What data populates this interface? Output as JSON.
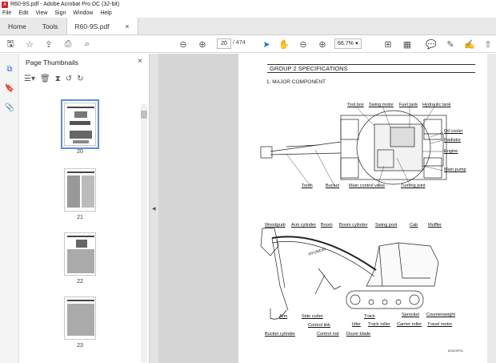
{
  "window": {
    "title": "R60-9S.pdf - Adobe Acrobat Pro DC (32-bit)"
  },
  "menu": [
    "File",
    "Edit",
    "View",
    "Sign",
    "Window",
    "Help"
  ],
  "tabs": {
    "home": "Home",
    "tools": "Tools",
    "document": "R60-9S.pdf"
  },
  "toolbar": {
    "page_current": "20",
    "page_separator": "/",
    "page_total": "474",
    "zoom": "66.7%"
  },
  "panel": {
    "title": "Page Thumbnails",
    "thumbnails": [
      {
        "label": "20"
      },
      {
        "label": "21"
      },
      {
        "label": "22"
      },
      {
        "label": "23"
      }
    ]
  },
  "document": {
    "heading": "GROUP  2  SPECIFICATIONS",
    "subheading": "1.  MAJOR COMPONENT",
    "top_labels": {
      "tool_box": "Tool box",
      "swing_motor": "Swing motor",
      "fuel_tank": "Fuel tank",
      "hydraulic_tank": "Hydraulic tank",
      "oil_cooler": "Oil cooler",
      "radiator": "Radiator",
      "engine": "Engine",
      "main_pump": "Main pump",
      "tooth": "Tooth",
      "bucket": "Bucket",
      "main_control_valve": "Main control valve",
      "turning_joint": "Turning joint"
    },
    "side_labels": {
      "woodgrab": "Woodgrab",
      "arm_cylinder": "Arm cylinder",
      "boom": "Boom",
      "boom_cylinder": "Boom cylinder",
      "swing_post": "Swing post",
      "cab": "Cab",
      "muffler": "Muffler",
      "counterweight": "Counterweight",
      "sprocket": "Sprocket",
      "arm": "Arm",
      "side_cutter": "Side cutter",
      "track": "Track",
      "track_roller": "Track roller",
      "carrier_roller": "Carrier roller",
      "travel_motor": "Travel motor",
      "control_link": "Control link",
      "idler": "Idler",
      "bucket_cylinder": "Bucket cylinder",
      "control_rod": "Control rod",
      "dozer_blade": "Dozer blade"
    },
    "figure_code": "6S02SP01",
    "boom_marking": "HYUNDAI"
  }
}
